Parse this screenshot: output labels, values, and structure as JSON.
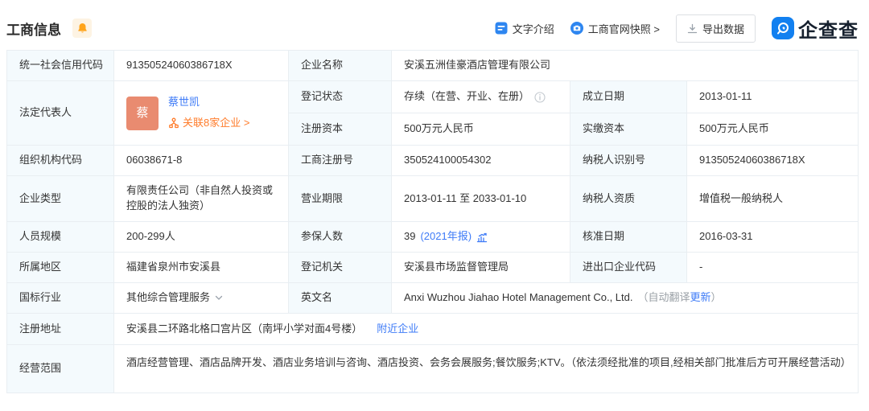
{
  "header": {
    "title": "工商信息",
    "actions": {
      "text_intro": "文字介绍",
      "snapshot": "工商官网快照 >",
      "export": "导出数据",
      "brand": "企查查"
    }
  },
  "fields": {
    "credit_code": {
      "label": "统一社会信用代码",
      "value": "91350524060386718X"
    },
    "company_name": {
      "label": "企业名称",
      "value": "安溪五洲佳豪酒店管理有限公司"
    },
    "legal_rep": {
      "label": "法定代表人",
      "avatar": "蔡",
      "name": "蔡世凯",
      "related": "关联8家企业 >"
    },
    "reg_status": {
      "label": "登记状态",
      "value": "存续（在营、开业、在册）"
    },
    "establish_date": {
      "label": "成立日期",
      "value": "2013-01-11"
    },
    "reg_capital": {
      "label": "注册资本",
      "value": "500万元人民币"
    },
    "paid_capital": {
      "label": "实缴资本",
      "value": "500万元人民币"
    },
    "org_code": {
      "label": "组织机构代码",
      "value": "06038671-8"
    },
    "reg_no": {
      "label": "工商注册号",
      "value": "350524100054302"
    },
    "taxpayer_id": {
      "label": "纳税人识别号",
      "value": "91350524060386718X"
    },
    "company_type": {
      "label": "企业类型",
      "value": "有限责任公司（非自然人投资或控股的法人独资）"
    },
    "business_term": {
      "label": "营业期限",
      "value": "2013-01-11 至 2033-01-10"
    },
    "taxpayer_quality": {
      "label": "纳税人资质",
      "value": "增值税一般纳税人"
    },
    "staff_size": {
      "label": "人员规模",
      "value": "200-299人"
    },
    "insured": {
      "label": "参保人数",
      "value": "39",
      "report": "(2021年报)"
    },
    "approval_date": {
      "label": "核准日期",
      "value": "2016-03-31"
    },
    "region": {
      "label": "所属地区",
      "value": "福建省泉州市安溪县"
    },
    "reg_authority": {
      "label": "登记机关",
      "value": "安溪县市场监督管理局"
    },
    "import_export_code": {
      "label": "进出口企业代码",
      "value": "-"
    },
    "industry": {
      "label": "国标行业",
      "value": "其他综合管理服务"
    },
    "english_name": {
      "label": "英文名",
      "value": "Anxi Wuzhou Jiahao Hotel Management Co., Ltd.",
      "note_prefix": "（自动翻译",
      "note_link": "更新",
      "note_suffix": "）"
    },
    "address": {
      "label": "注册地址",
      "value": "安溪县二环路北格口宫片区（南坪小学对面4号楼）",
      "nearby": "附近企业"
    },
    "business_scope": {
      "label": "经营范围",
      "value": "酒店经营管理、酒店品牌开发、酒店业务培训与咨询、酒店投资、会务会展服务;餐饮服务;KTV。（依法须经批准的项目,经相关部门批准后方可开展经营活动）"
    }
  },
  "colors": {
    "link_blue": "#3E7BF7",
    "orange_link": "#FF7C2B",
    "avatar_bg": "#E98B70",
    "bell_orange": "#FFA41B",
    "brand_blue": "#1280F0",
    "label_bg": "#F4FAFD",
    "border": "#E9EEF2",
    "text": "#333333"
  }
}
